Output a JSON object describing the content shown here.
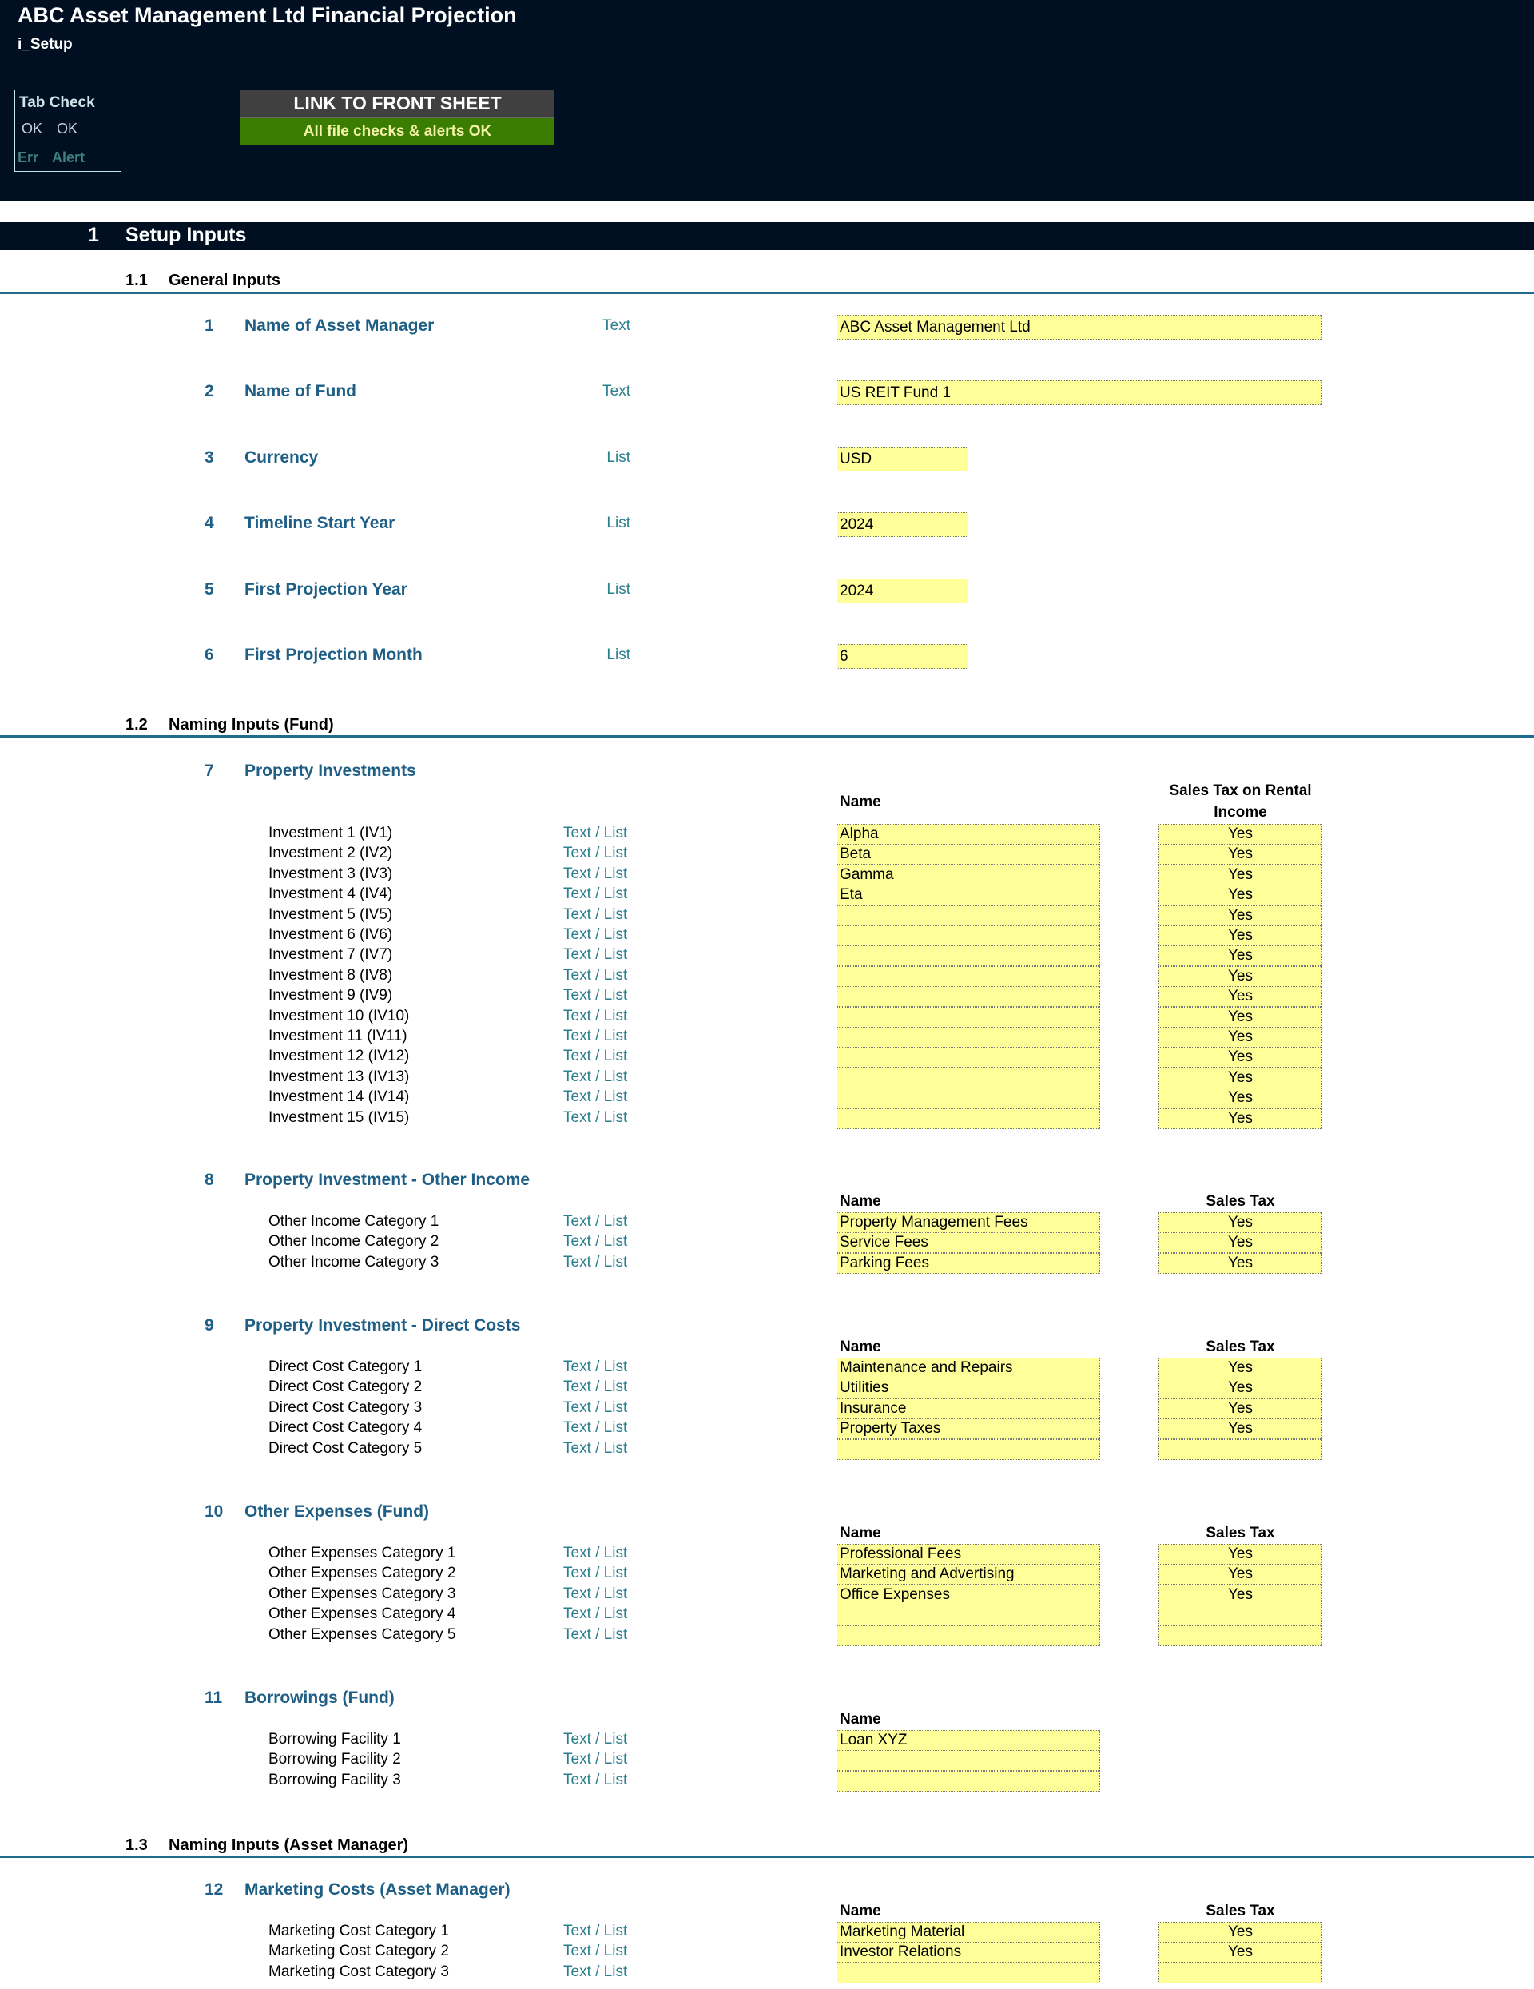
{
  "header": {
    "title": "ABC Asset Management Ltd Financial Projection",
    "sheet_name": "i_Setup",
    "tab_check": {
      "title": "Tab Check",
      "ok1": "OK",
      "ok2": "OK",
      "err": "Err",
      "alert": "Alert"
    },
    "link_button": "LINK TO FRONT SHEET",
    "status": "All file checks & alerts OK",
    "colors": {
      "background": "#001022",
      "status_green": "#3a7d00",
      "input_yellow": "#ffff99",
      "label_blue": "#1f5f86"
    }
  },
  "section": {
    "number": "1",
    "title": "Setup Inputs"
  },
  "general": {
    "number": "1.1",
    "title": "General Inputs",
    "items": [
      {
        "num": "1",
        "label": "Name of Asset Manager",
        "type": "Text",
        "value": "ABC Asset Management Ltd"
      },
      {
        "num": "2",
        "label": "Name of Fund",
        "type": "Text",
        "value": "US REIT Fund 1"
      },
      {
        "num": "3",
        "label": "Currency",
        "type": "List",
        "value": "USD"
      },
      {
        "num": "4",
        "label": "Timeline Start Year",
        "type": "List",
        "value": "2024"
      },
      {
        "num": "5",
        "label": "First Projection Year",
        "type": "List",
        "value": "2024"
      },
      {
        "num": "6",
        "label": "First Projection Month",
        "type": "List",
        "value": "6"
      }
    ]
  },
  "naming_fund": {
    "number": "1.2",
    "title": "Naming Inputs (Fund)",
    "groups": [
      {
        "num": "7",
        "title": "Property Investments",
        "name_header": "Name",
        "tax_header_1": "Sales Tax on Rental",
        "tax_header_2": "Income",
        "rows": [
          {
            "label": "Investment 1 (IV1)",
            "type": "Text / List",
            "name": "Alpha",
            "tax": "Yes"
          },
          {
            "label": "Investment 2 (IV2)",
            "type": "Text / List",
            "name": "Beta",
            "tax": "Yes"
          },
          {
            "label": "Investment 3 (IV3)",
            "type": "Text / List",
            "name": "Gamma",
            "tax": "Yes"
          },
          {
            "label": "Investment 4 (IV4)",
            "type": "Text / List",
            "name": "Eta",
            "tax": "Yes"
          },
          {
            "label": "Investment 5 (IV5)",
            "type": "Text / List",
            "name": "",
            "tax": "Yes"
          },
          {
            "label": "Investment 6 (IV6)",
            "type": "Text / List",
            "name": "",
            "tax": "Yes"
          },
          {
            "label": "Investment 7 (IV7)",
            "type": "Text / List",
            "name": "",
            "tax": "Yes"
          },
          {
            "label": "Investment 8 (IV8)",
            "type": "Text / List",
            "name": "",
            "tax": "Yes"
          },
          {
            "label": "Investment 9 (IV9)",
            "type": "Text / List",
            "name": "",
            "tax": "Yes"
          },
          {
            "label": "Investment 10 (IV10)",
            "type": "Text / List",
            "name": "",
            "tax": "Yes"
          },
          {
            "label": "Investment 11 (IV11)",
            "type": "Text / List",
            "name": "",
            "tax": "Yes"
          },
          {
            "label": "Investment 12 (IV12)",
            "type": "Text / List",
            "name": "",
            "tax": "Yes"
          },
          {
            "label": "Investment 13 (IV13)",
            "type": "Text / List",
            "name": "",
            "tax": "Yes"
          },
          {
            "label": "Investment 14 (IV14)",
            "type": "Text / List",
            "name": "",
            "tax": "Yes"
          },
          {
            "label": "Investment 15 (IV15)",
            "type": "Text / List",
            "name": "",
            "tax": "Yes"
          }
        ]
      },
      {
        "num": "8",
        "title": "Property Investment - Other Income",
        "name_header": "Name",
        "tax_header_1": "Sales Tax",
        "rows": [
          {
            "label": "Other Income Category 1",
            "type": "Text / List",
            "name": "Property Management Fees",
            "tax": "Yes"
          },
          {
            "label": "Other Income Category 2",
            "type": "Text / List",
            "name": "Service Fees",
            "tax": "Yes"
          },
          {
            "label": "Other Income Category 3",
            "type": "Text / List",
            "name": "Parking Fees",
            "tax": "Yes"
          }
        ]
      },
      {
        "num": "9",
        "title": "Property Investment - Direct Costs",
        "name_header": "Name",
        "tax_header_1": "Sales Tax",
        "rows": [
          {
            "label": "Direct Cost Category 1",
            "type": "Text / List",
            "name": "Maintenance and Repairs",
            "tax": "Yes"
          },
          {
            "label": "Direct Cost Category 2",
            "type": "Text / List",
            "name": "Utilities",
            "tax": "Yes"
          },
          {
            "label": "Direct Cost Category 3",
            "type": "Text / List",
            "name": "Insurance",
            "tax": "Yes"
          },
          {
            "label": "Direct Cost Category 4",
            "type": "Text / List",
            "name": "Property Taxes",
            "tax": "Yes"
          },
          {
            "label": "Direct Cost Category 5",
            "type": "Text / List",
            "name": "",
            "tax": ""
          }
        ]
      },
      {
        "num": "10",
        "title": "Other Expenses (Fund)",
        "name_header": "Name",
        "tax_header_1": "Sales Tax",
        "rows": [
          {
            "label": "Other Expenses Category 1",
            "type": "Text / List",
            "name": "Professional Fees",
            "tax": "Yes"
          },
          {
            "label": "Other Expenses Category 2",
            "type": "Text / List",
            "name": "Marketing and Advertising",
            "tax": "Yes"
          },
          {
            "label": "Other Expenses Category 3",
            "type": "Text / List",
            "name": "Office Expenses",
            "tax": "Yes"
          },
          {
            "label": "Other Expenses Category 4",
            "type": "Text / List",
            "name": "",
            "tax": ""
          },
          {
            "label": "Other Expenses Category 5",
            "type": "Text / List",
            "name": "",
            "tax": ""
          }
        ]
      },
      {
        "num": "11",
        "title": "Borrowings (Fund)",
        "name_header": "Name",
        "rows": [
          {
            "label": "Borrowing Facility 1",
            "type": "Text / List",
            "name": "Loan XYZ"
          },
          {
            "label": "Borrowing Facility 2",
            "type": "Text / List",
            "name": ""
          },
          {
            "label": "Borrowing Facility 3",
            "type": "Text / List",
            "name": ""
          }
        ]
      }
    ]
  },
  "naming_am": {
    "number": "1.3",
    "title": "Naming Inputs (Asset Manager)",
    "groups": [
      {
        "num": "12",
        "title": "Marketing Costs (Asset Manager)",
        "name_header": "Name",
        "tax_header_1": "Sales Tax",
        "rows": [
          {
            "label": "Marketing Cost Category 1",
            "type": "Text / List",
            "name": "Marketing Material",
            "tax": "Yes"
          },
          {
            "label": "Marketing Cost Category 2",
            "type": "Text / List",
            "name": "Investor Relations",
            "tax": "Yes"
          },
          {
            "label": "Marketing Cost Category 3",
            "type": "Text / List",
            "name": "",
            "tax": ""
          }
        ]
      }
    ]
  }
}
